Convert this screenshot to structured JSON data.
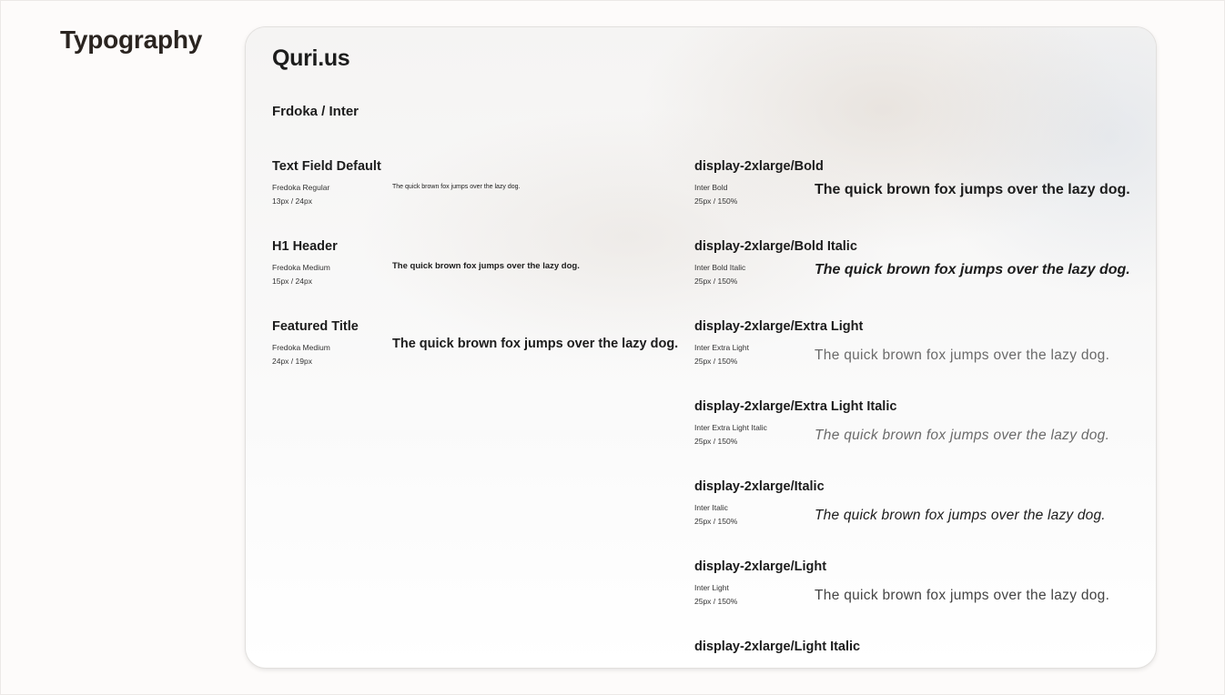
{
  "section": {
    "heading": "Typography"
  },
  "card": {
    "brand": "Quri.us",
    "font_pair": "Frdoka / Inter"
  },
  "left_styles": [
    {
      "title": "Text Field Default",
      "font": "Fredoka Regular",
      "size": "13px / 24px",
      "sample": "The quick brown fox jumps over the lazy dog."
    },
    {
      "title": "H1 Header",
      "font": "Fredoka Medium",
      "size": "15px / 24px",
      "sample": "The quick brown fox jumps over the lazy dog."
    },
    {
      "title": "Featured Title",
      "font": "Fredoka Medium",
      "size": "24px / 19px",
      "sample": "The quick brown fox jumps over the lazy dog."
    }
  ],
  "right_styles": [
    {
      "title": "display-2xlarge/Bold",
      "font": "Inter Bold",
      "size": "25px / 150%",
      "sample": "The quick brown fox jumps over the lazy dog."
    },
    {
      "title": "display-2xlarge/Bold Italic",
      "font": "Inter Bold Italic",
      "size": "25px / 150%",
      "sample": "The quick brown fox jumps over the lazy dog."
    },
    {
      "title": "display-2xlarge/Extra Light",
      "font": "Inter Extra Light",
      "size": "25px / 150%",
      "sample": "The quick brown fox jumps over the lazy dog."
    },
    {
      "title": "display-2xlarge/Extra Light Italic",
      "font": "Inter Extra Light Italic",
      "size": "25px / 150%",
      "sample": "The quick brown fox jumps over the lazy dog."
    },
    {
      "title": "display-2xlarge/Italic",
      "font": "Inter Italic",
      "size": "25px / 150%",
      "sample": "The quick brown fox jumps over the lazy dog."
    },
    {
      "title": "display-2xlarge/Light",
      "font": "Inter Light",
      "size": "25px / 150%",
      "sample": "The quick brown fox jumps over the lazy dog."
    },
    {
      "title": "display-2xlarge/Light Italic"
    }
  ]
}
